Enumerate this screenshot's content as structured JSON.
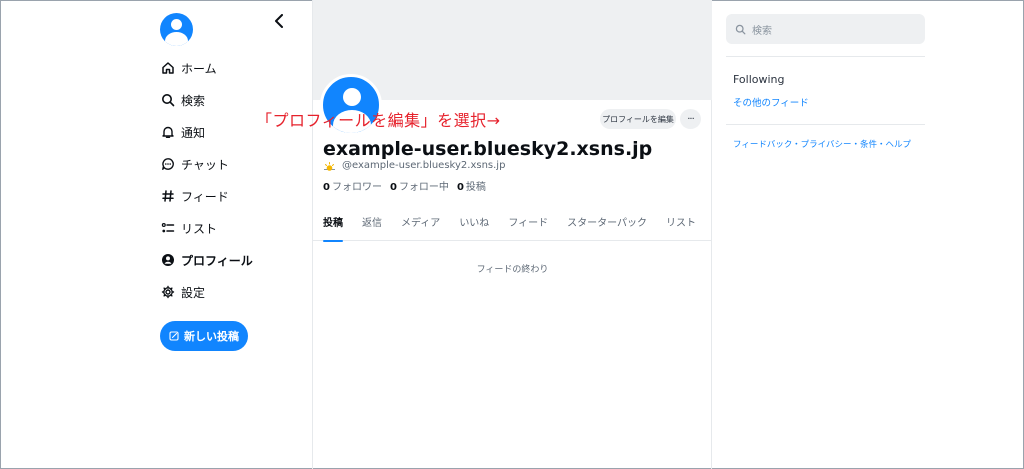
{
  "sidebar": {
    "back_glyph": "‹",
    "items": [
      {
        "label": "ホーム",
        "icon": "home-icon"
      },
      {
        "label": "検索",
        "icon": "search-icon"
      },
      {
        "label": "通知",
        "icon": "bell-icon"
      },
      {
        "label": "チャット",
        "icon": "chat-icon"
      },
      {
        "label": "フィード",
        "icon": "hash-icon"
      },
      {
        "label": "リスト",
        "icon": "list-icon"
      },
      {
        "label": "プロフィール",
        "icon": "profile-icon",
        "active": true
      },
      {
        "label": "設定",
        "icon": "gear-icon"
      }
    ],
    "new_post_label": "新しい投稿"
  },
  "profile": {
    "edit_button_label": "プロフィールを編集",
    "more_label": "···",
    "display_name": "example-user.bluesky2.xsns.jp",
    "handle": "@example-user.bluesky2.xsns.jp",
    "stats": {
      "followers_count": "0",
      "followers_label": "フォロワー",
      "following_count": "0",
      "following_label": "フォロー中",
      "posts_count": "0",
      "posts_label": "投稿"
    },
    "tabs": [
      "投稿",
      "返信",
      "メディア",
      "いいね",
      "フィード",
      "スターターパック",
      "リスト"
    ],
    "active_tab": "投稿",
    "feed_end_text": "フィードの終わり"
  },
  "annotation": {
    "text": "「プロフィールを編集」を選択→",
    "color": "#e6222c"
  },
  "right": {
    "search_placeholder": "検索",
    "feeds_heading": "Following",
    "other_feeds_link": "その他のフィード",
    "footer_links": "フィードバック・プライバシー・条件・ヘルプ"
  },
  "colors": {
    "accent": "#1185fe",
    "banner": "#eef0f2",
    "text_primary": "#0b0f14",
    "text_secondary": "#5d6875"
  }
}
